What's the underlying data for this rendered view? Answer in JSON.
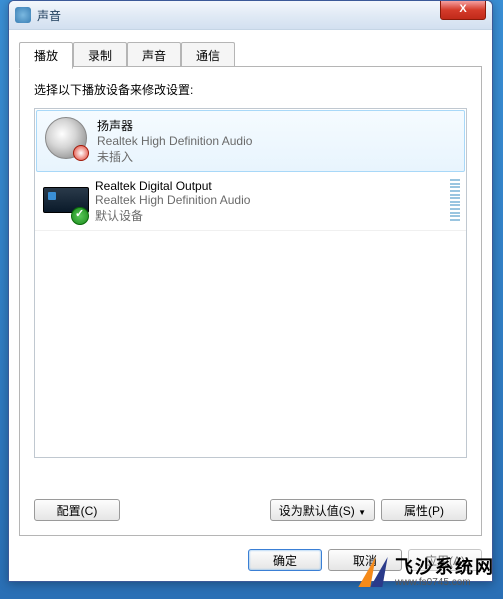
{
  "window": {
    "title": "声音",
    "close_label": "X"
  },
  "tabs": {
    "play": "播放",
    "record": "录制",
    "sounds": "声音",
    "comm": "通信"
  },
  "content": {
    "instruction": "选择以下播放设备来修改设置:"
  },
  "devices": [
    {
      "name": "扬声器",
      "driver": "Realtek High Definition Audio",
      "status": "未插入",
      "selected": true,
      "has_meter": false,
      "icon": "speaker"
    },
    {
      "name": "Realtek Digital Output",
      "driver": "Realtek High Definition Audio",
      "status": "默认设备",
      "selected": false,
      "has_meter": true,
      "icon": "spdif"
    }
  ],
  "buttons": {
    "configure": "配置(C)",
    "set_default": "设为默认值(S)",
    "dropdown": "▼",
    "properties": "属性(P)",
    "ok": "确定",
    "cancel": "取消",
    "apply": "应用(A)"
  },
  "watermark": {
    "name": "飞沙系统网",
    "url": "www.fs0745.com"
  }
}
